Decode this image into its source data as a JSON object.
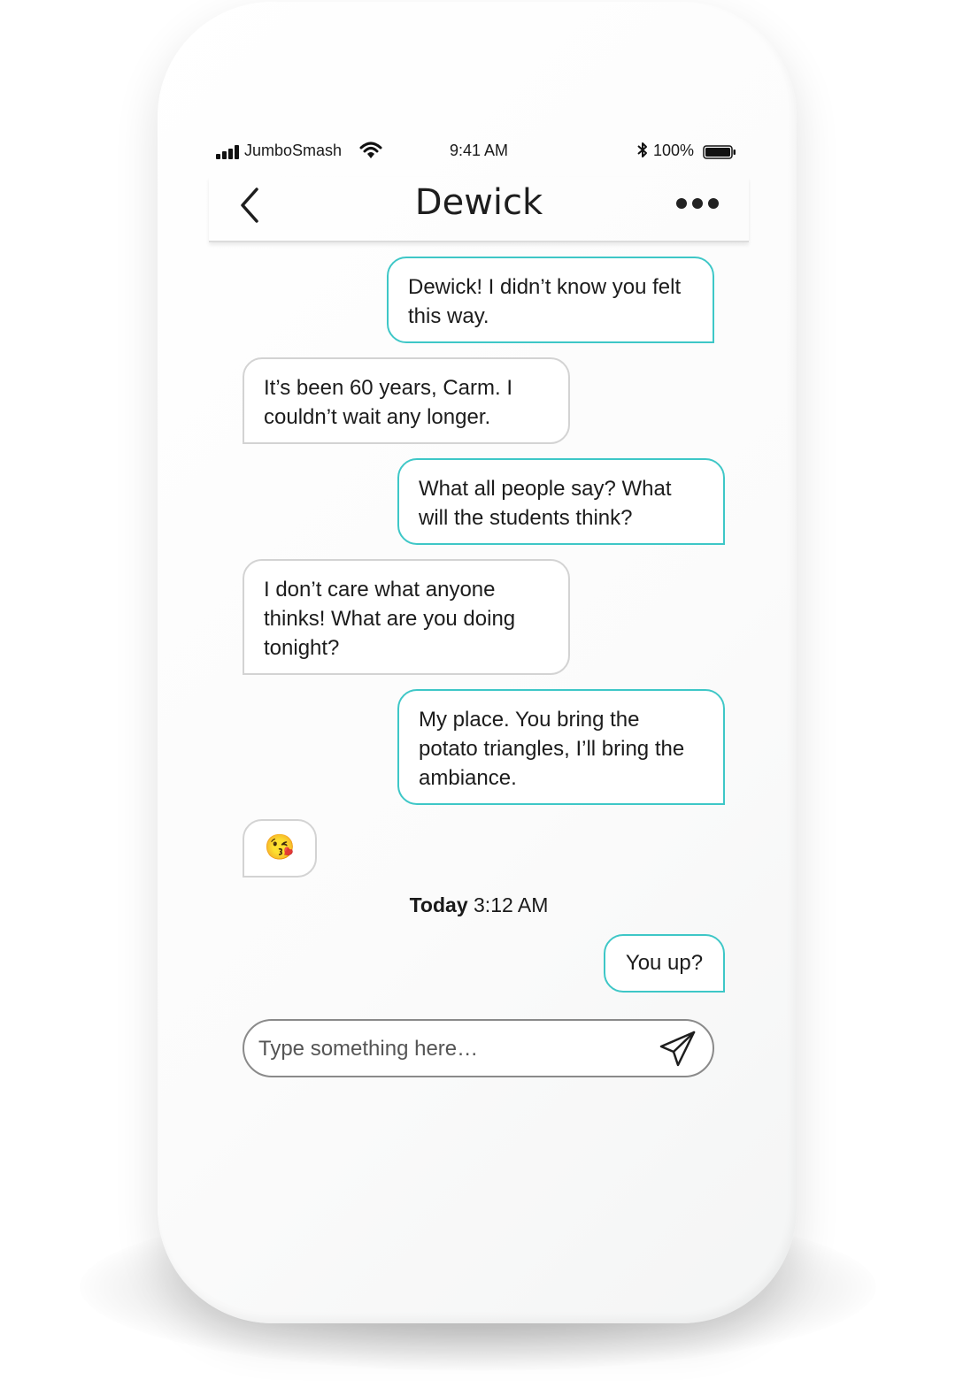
{
  "status_bar": {
    "carrier": "JumboSmash",
    "time": "9:41 AM",
    "battery": "100%"
  },
  "nav": {
    "title": "Dewick"
  },
  "messages": [
    {
      "direction": "out",
      "text": "Dewick! I didn’t know you felt this way."
    },
    {
      "direction": "in",
      "text": "It’s been 60 years, Carm. I couldn’t wait any longer."
    },
    {
      "direction": "out",
      "text": "What all people say? What will the students think?"
    },
    {
      "direction": "in",
      "text": "I don’t care what anyone thinks! What are you doing tonight?"
    },
    {
      "direction": "out",
      "text": "My place. You bring the potato triangles, I’ll bring the ambiance."
    },
    {
      "direction": "in",
      "text": "😘"
    },
    {
      "direction": "out",
      "text": "You up?"
    }
  ],
  "timestamp": {
    "day": "Today",
    "time": "3:12 AM"
  },
  "composer": {
    "placeholder": "Type something here…"
  },
  "colors": {
    "outgoing_border": "#3ec7c7",
    "incoming_border": "#d3d3d3"
  },
  "icons": {
    "back": "chevron-left-icon",
    "more": "ellipsis-icon",
    "send": "paper-plane-icon",
    "signal": "signal-bars-icon",
    "wifi": "wifi-icon",
    "bluetooth": "bluetooth-icon",
    "battery": "battery-icon"
  }
}
